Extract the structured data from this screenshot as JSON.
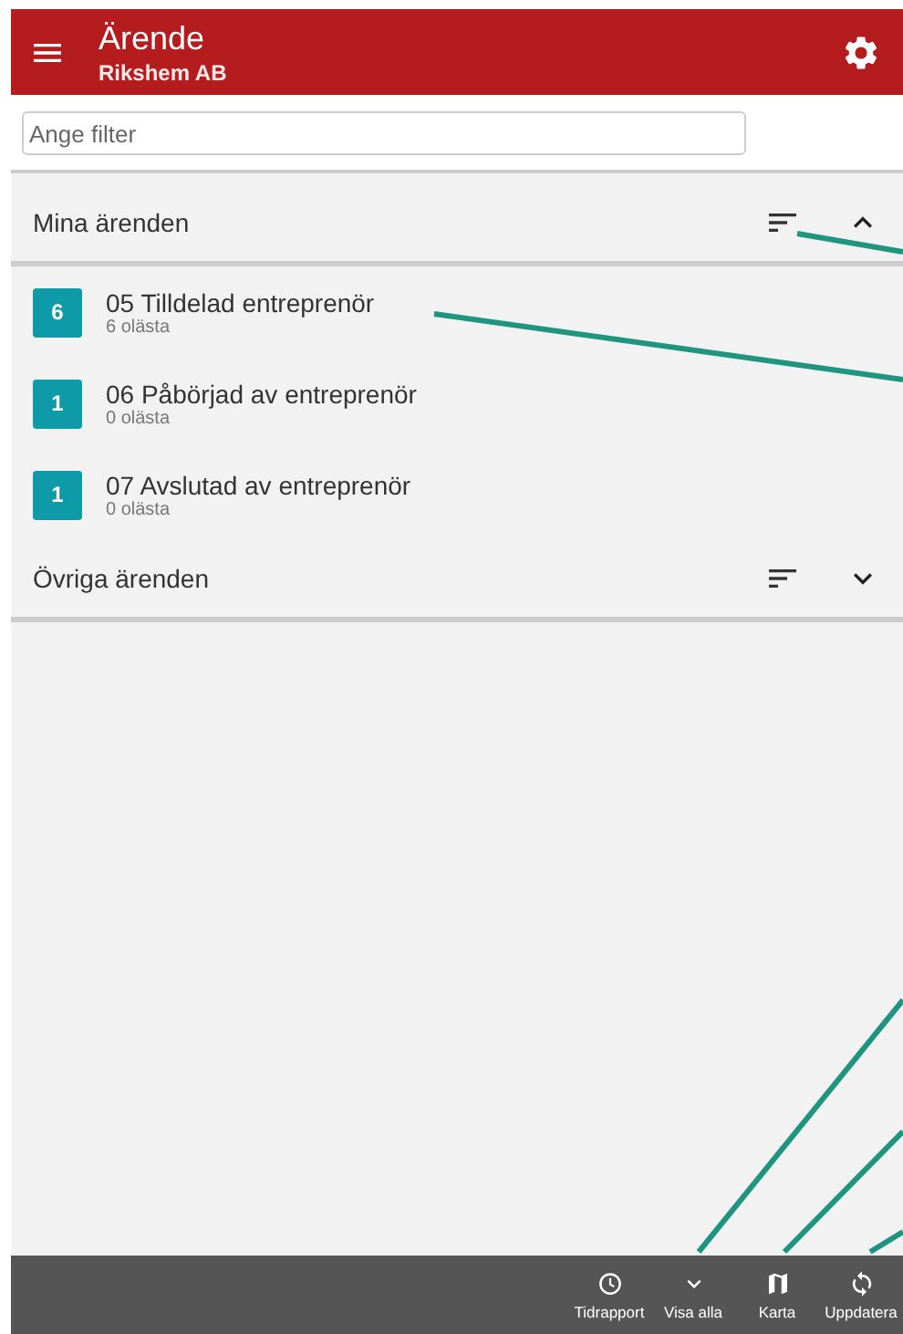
{
  "app_bar": {
    "title": "Ärende",
    "subtitle": "Rikshem AB"
  },
  "filter": {
    "placeholder": "Ange filter"
  },
  "groups": [
    {
      "title": "Mina ärenden",
      "expanded": true,
      "items": [
        {
          "count": "6",
          "title": "05 Tilldelad entreprenör",
          "unread": "6 olästa"
        },
        {
          "count": "1",
          "title": "06 Påbörjad av entreprenör",
          "unread": "0 olästa"
        },
        {
          "count": "1",
          "title": "07 Avslutad av entreprenör",
          "unread": "0 olästa"
        }
      ]
    },
    {
      "title": "Övriga ärenden",
      "expanded": false
    }
  ],
  "bottom_bar": [
    {
      "kind": "clock",
      "label": "Tidrapport"
    },
    {
      "kind": "chevron",
      "label": "Visa alla"
    },
    {
      "kind": "map",
      "label": "Karta"
    },
    {
      "kind": "refresh",
      "label": "Uppdatera"
    }
  ]
}
